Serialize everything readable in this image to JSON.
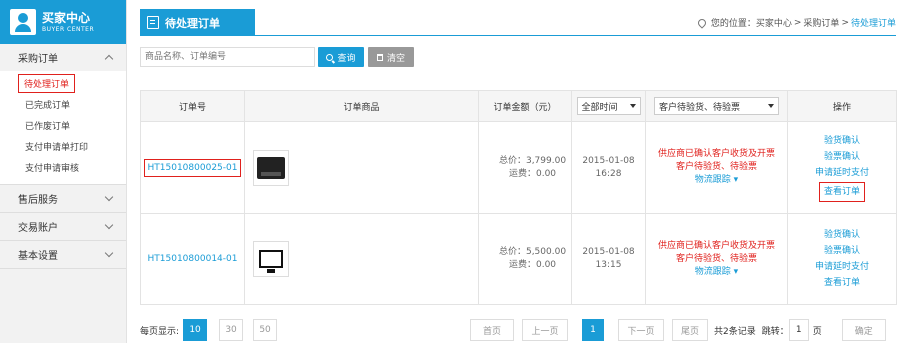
{
  "brand": {
    "title": "买家中心",
    "subtitle": "BUYER CENTER"
  },
  "sidebar": {
    "groups": [
      {
        "label": "采购订单",
        "items": [
          "待处理订单",
          "已完成订单",
          "已作废订单",
          "支付申请单打印",
          "支付申请审核"
        ]
      },
      {
        "label": "售后服务"
      },
      {
        "label": "交易账户"
      },
      {
        "label": "基本设置"
      }
    ]
  },
  "header": {
    "title": "待处理订单",
    "breadcrumb": {
      "prefix": "您的位置：",
      "items": [
        "买家中心",
        "采购订单",
        "待处理订单"
      ],
      "sep": ">"
    }
  },
  "search": {
    "placeholder": "商品名称、订单编号",
    "search_label": "查询",
    "clear_label": "清空"
  },
  "table": {
    "headers": {
      "order_no": "订单号",
      "goods": "订单商品",
      "amount": "订单金额（元）",
      "time": "全部时间",
      "status": "客户待验货、待验票",
      "ops": "操作"
    },
    "rows": [
      {
        "order_no": "HT15010800025-01",
        "total_label": "总价：",
        "total": "3,799.00",
        "freight_label": "运费：",
        "freight": "0.00",
        "date": "2015-01-08",
        "time": "16:28",
        "status_lines": [
          "供应商已确认客户收货及开票",
          "客户待验货、待验票"
        ],
        "track": "物流跟踪",
        "ops": [
          "验货确认",
          "验票确认",
          "申请延时支付",
          "查看订单"
        ]
      },
      {
        "order_no": "HT15010800014-01",
        "total_label": "总价：",
        "total": "5,500.00",
        "freight_label": "运费：",
        "freight": "0.00",
        "date": "2015-01-08",
        "time": "13:15",
        "status_lines": [
          "供应商已确认客户收货及开票",
          "客户待验货、待验票"
        ],
        "track": "物流跟踪",
        "ops": [
          "验货确认",
          "验票确认",
          "申请延时支付",
          "查看订单"
        ]
      }
    ]
  },
  "pagination": {
    "per_page_label": "每页显示:",
    "sizes": [
      "10",
      "30",
      "50"
    ],
    "first": "首页",
    "prev": "上一页",
    "current": "1",
    "next": "下一页",
    "last": "尾页",
    "total": "共2条记录",
    "jump_label": "跳转：",
    "page_value": "1",
    "page_unit": "页",
    "confirm": "确定"
  },
  "colors": {
    "accent": "#1a9cd6",
    "highlight": "#e0211d"
  }
}
